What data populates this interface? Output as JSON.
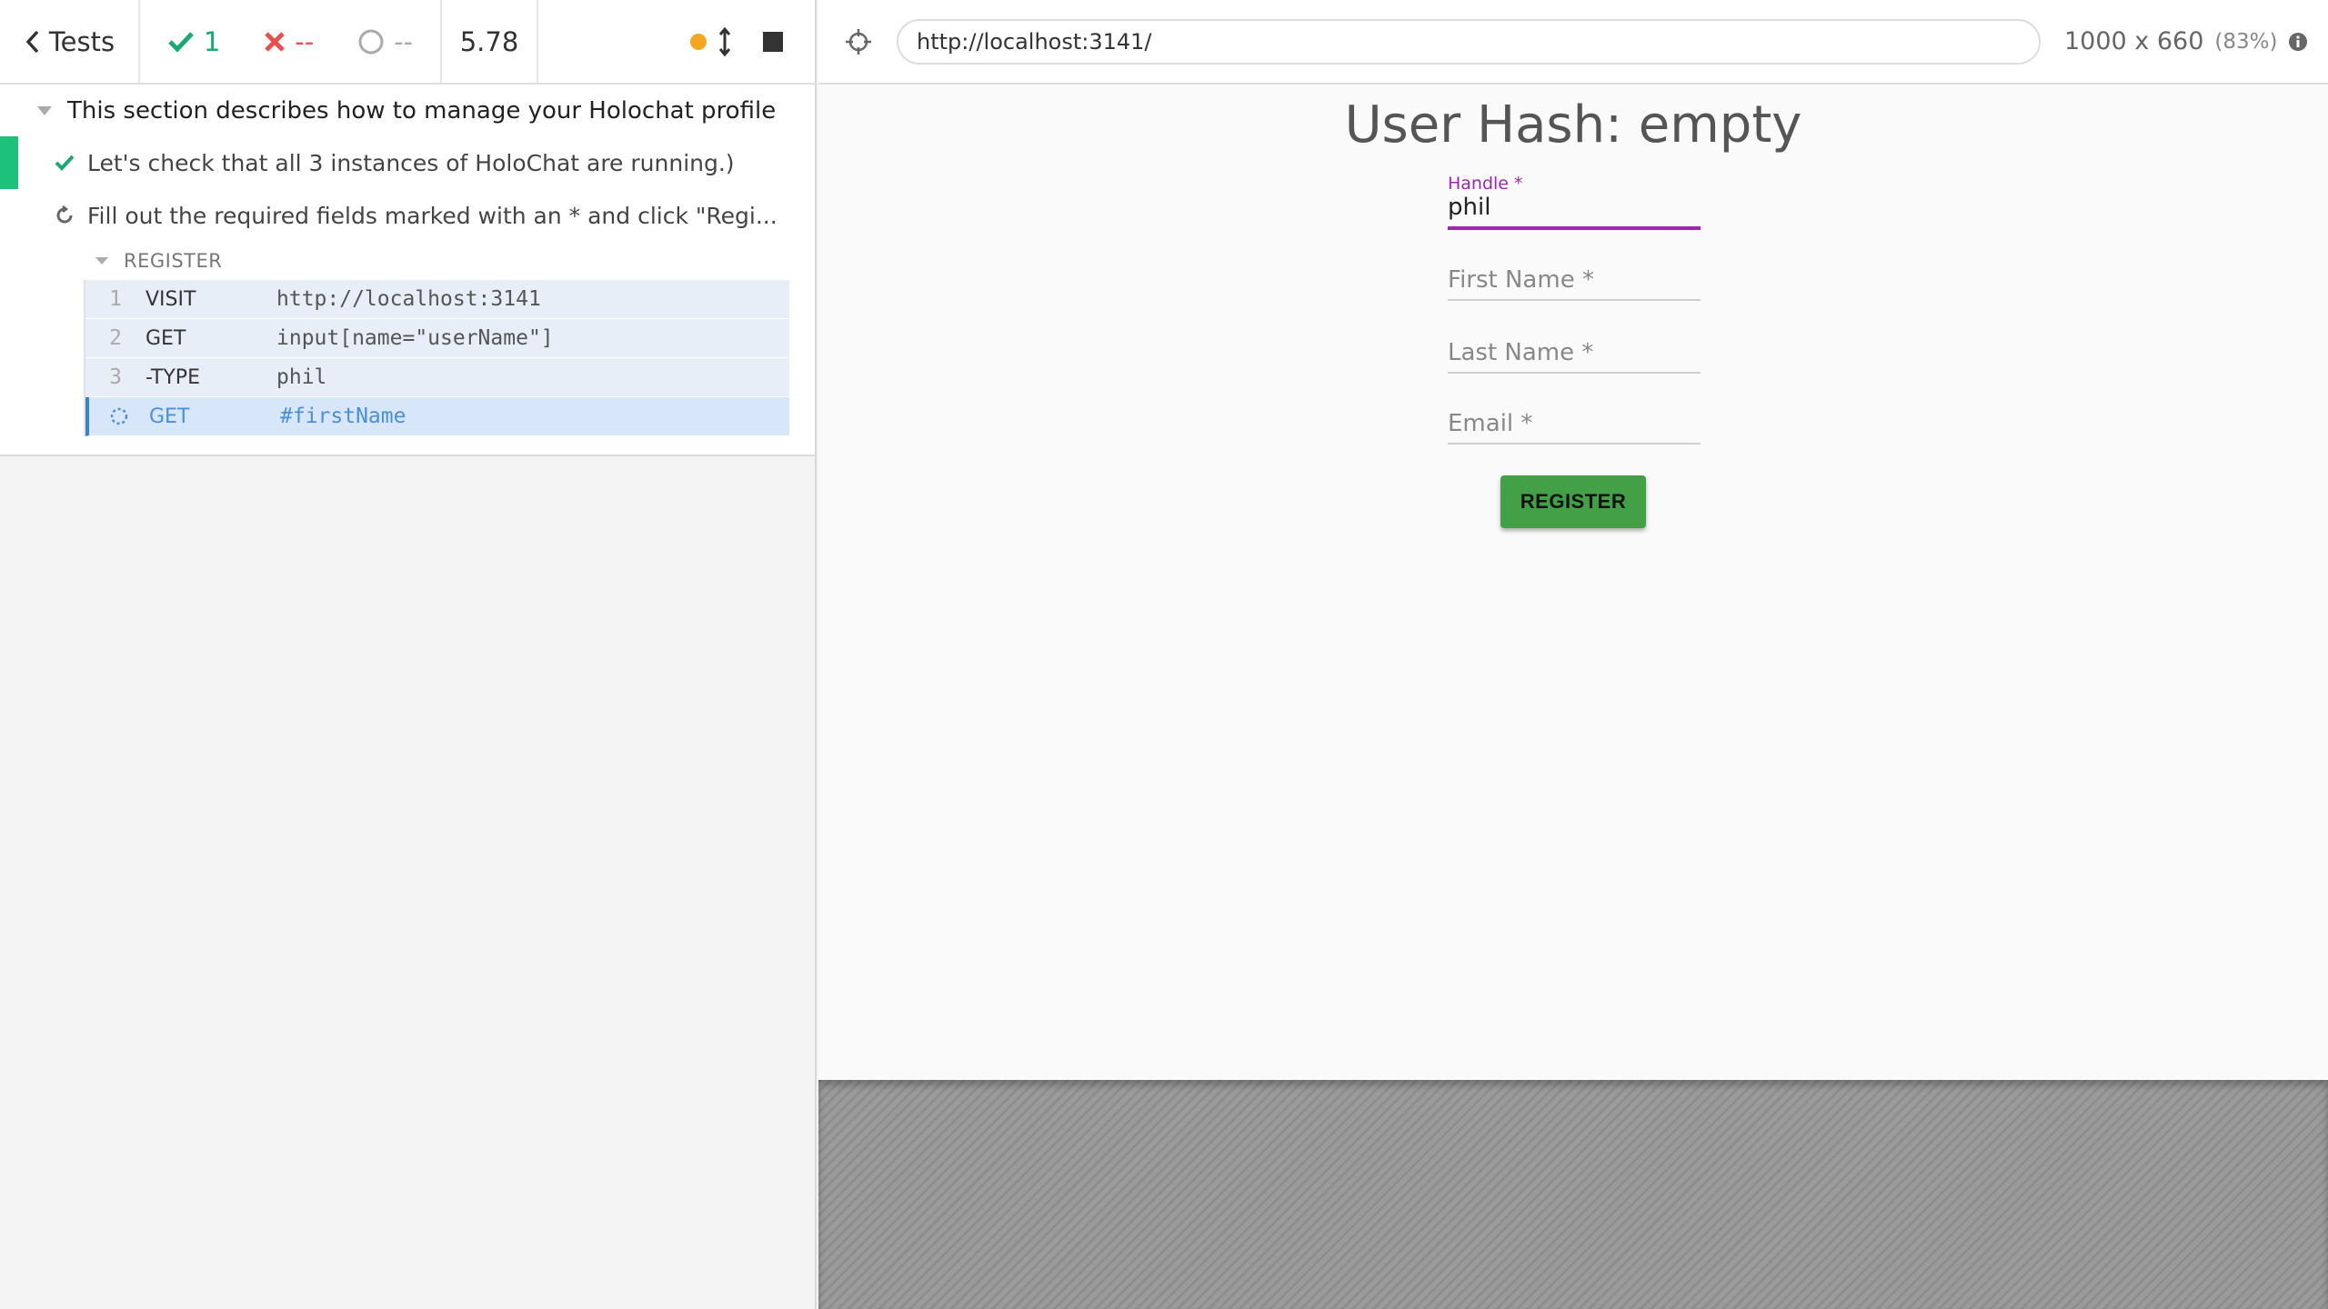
{
  "stats": {
    "tests_label": "Tests",
    "passed": "1",
    "failed": "--",
    "pending": "--",
    "duration": "5.78"
  },
  "runnable": {
    "suite_title": "This section describes how to manage your Holochat profile",
    "tests": [
      {
        "title": "Let's check that all 3 instances of HoloChat are running.)",
        "state": "passed"
      },
      {
        "title": "Fill out the required fields marked with an * and click \"Regi...",
        "state": "running"
      }
    ],
    "hook_label": "REGISTER",
    "commands": [
      {
        "num": "1",
        "name": "VISIT",
        "message": "http://localhost:3141"
      },
      {
        "num": "2",
        "name": "GET",
        "message": "input[name=\"userName\"]"
      },
      {
        "num": "3",
        "name": "-TYPE",
        "message": "phil"
      },
      {
        "num": "",
        "name": "GET",
        "message": "#firstName",
        "active": true
      }
    ]
  },
  "aut": {
    "url": "http://localhost:3141/",
    "viewport": "1000 x 660",
    "scale": "(83%)"
  },
  "app": {
    "heading": "User Hash: empty",
    "handle_label": "Handle *",
    "handle_value": "phil",
    "first_name_placeholder": "First Name *",
    "last_name_placeholder": "Last Name *",
    "email_placeholder": "Email *",
    "register_label": "REGISTER"
  },
  "colors": {
    "pass": "#1aa971",
    "fail": "#e94f4f",
    "accent_purple": "#9c27b0",
    "register_green": "#43a047",
    "active_command": "#4a90d9"
  }
}
